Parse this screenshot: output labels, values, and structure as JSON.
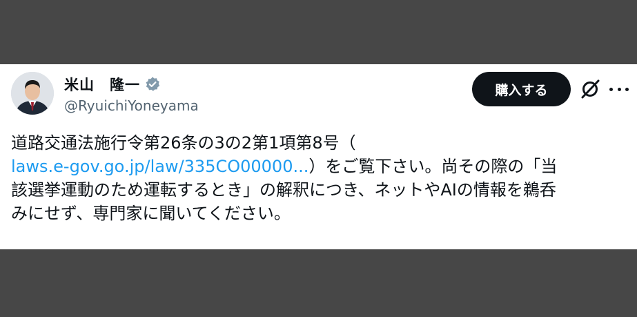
{
  "author": {
    "display_name": "米山　隆一",
    "handle": "@RyuichiYoneyama",
    "verified": true,
    "avatar": "avatar"
  },
  "actions": {
    "buy_label": "購入する",
    "grok_icon": "grok-icon",
    "more_icon": "more-icon"
  },
  "tweet": {
    "line1": "道路交通法施行令第26条の3の2第1項第8号（",
    "link_text": "laws.e-gov.go.jp/law/335CO00000...",
    "line2_rest": "）をご覧下さい。尚その際の「当",
    "line3": "該選挙運動のため運転するとき」の解釈につき、ネットやAIの情報を鵜呑",
    "line4": "みにせず、専門家に聞いてください。"
  },
  "colors": {
    "background": "#474747",
    "card": "#ffffff",
    "text": "#0f1419",
    "secondary_text": "#536471",
    "link": "#1d9bf0",
    "button": "#0f1419",
    "verified_badge": "#829aab"
  }
}
